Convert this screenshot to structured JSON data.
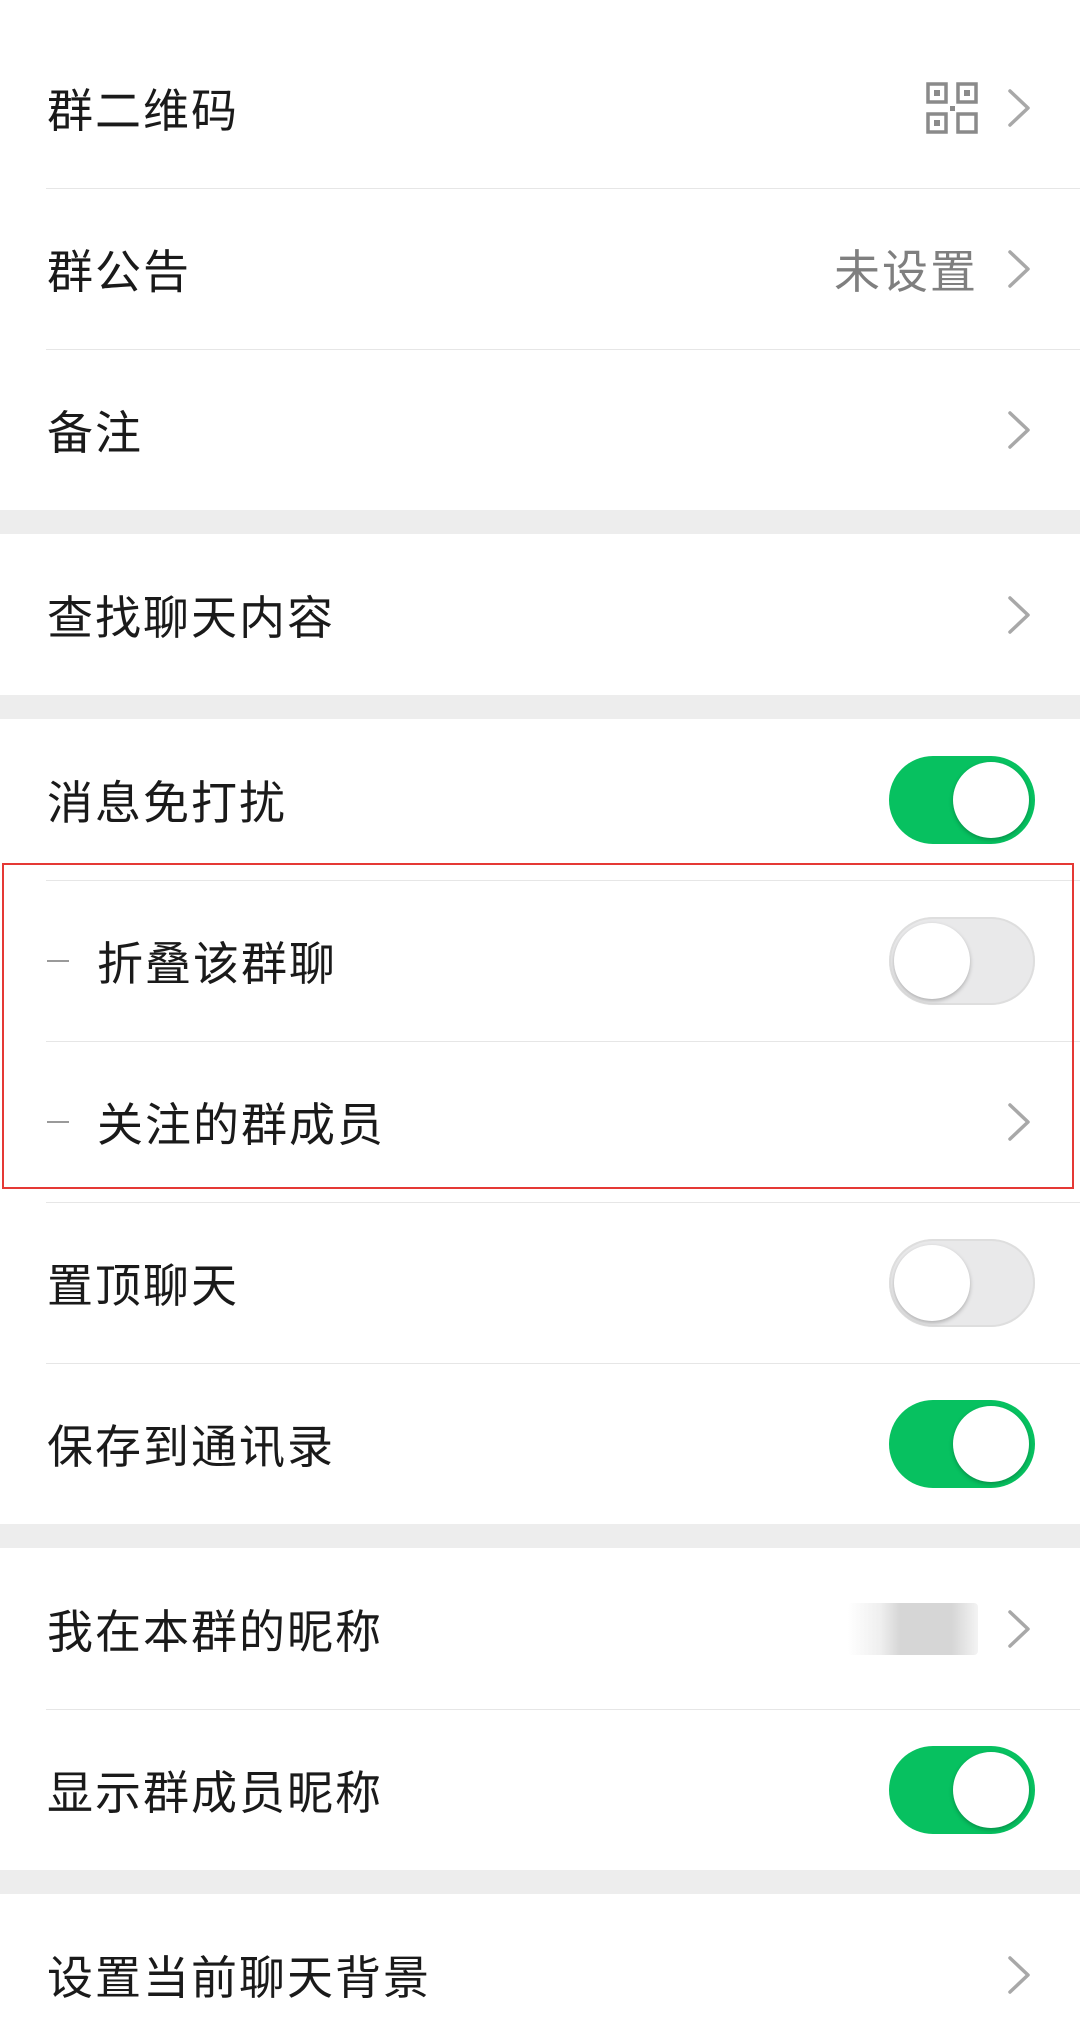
{
  "section1": {
    "qr_label": "群二维码",
    "announcement_label": "群公告",
    "announcement_value": "未设置",
    "remark_label": "备注"
  },
  "section2": {
    "search_label": "查找聊天内容"
  },
  "section3": {
    "mute": {
      "label": "消息免打扰",
      "on": true
    },
    "fold": {
      "label": "折叠该群聊",
      "on": false
    },
    "followed_members": {
      "label": "关注的群成员"
    },
    "pin": {
      "label": "置顶聊天",
      "on": false
    },
    "save_contacts": {
      "label": "保存到通讯录",
      "on": true
    }
  },
  "section4": {
    "my_nickname_label": "我在本群的昵称",
    "show_nicknames": {
      "label": "显示群成员昵称",
      "on": true
    }
  },
  "section5": {
    "background_label": "设置当前聊天背景"
  },
  "colors": {
    "toggle_on": "#07c160",
    "highlight_border": "#e53935"
  }
}
